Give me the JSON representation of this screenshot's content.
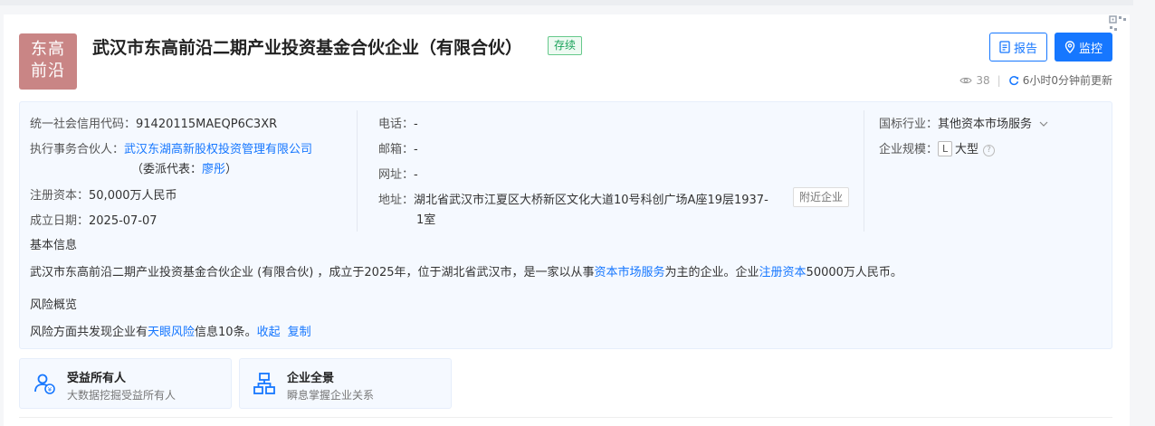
{
  "company": {
    "logo_line1": "东高",
    "logo_line2": "前沿",
    "name": "武汉市东高前沿二期产业投资基金合伙企业（有限合伙）",
    "status": "存续"
  },
  "actions": {
    "report_label": "报告",
    "monitor_label": "监控"
  },
  "meta": {
    "views": "38",
    "updated": "6小时0分钟前更新"
  },
  "info": {
    "credit_code_label": "统一社会信用代码：",
    "credit_code": "91420115MAEQP6C3XR",
    "partner_label": "执行事务合伙人：",
    "partner": "武汉东湖高新股权投资管理有限公司",
    "rep_prefix": "（委派代表：",
    "rep_name": "廖彤",
    "rep_suffix": "）",
    "capital_label": "注册资本：",
    "capital": "50,000万人民币",
    "founded_label": "成立日期：",
    "founded": "2025-07-07",
    "phone_label": "电话：",
    "phone": "-",
    "email_label": "邮箱：",
    "email": "-",
    "website_label": "网址：",
    "website": "-",
    "address_label": "地址：",
    "address_line1": "湖北省武汉市江夏区大桥新区文化大道10号科创广场A座19层1937-",
    "address_line2": "1室",
    "nearby_label": "附近企业",
    "industry_label": "国标行业：",
    "industry": "其他资本市场服务",
    "scale_label": "企业规模：",
    "scale_letter": "L",
    "scale": "大型"
  },
  "basic": {
    "heading": "基本信息",
    "text_1": "武汉市东高前沿二期产业投资基金合伙企业 (有限合伙) ，成立于2025年，位于湖北省武汉市，是一家以从事",
    "link_1": "资本市场服务",
    "text_2": "为主的企业。企业",
    "link_2": "注册资本",
    "text_3": "50000万人民币。"
  },
  "risk": {
    "heading": "风险概览",
    "text_1": "风险方面共发现企业有",
    "link_1": "天眼风险",
    "text_2": "信息10条。",
    "collapse": "收起",
    "copy": "复制"
  },
  "features": [
    {
      "title": "受益所有人",
      "subtitle": "大数据挖掘受益所有人",
      "icon": "beneficiary-icon"
    },
    {
      "title": "企业全景",
      "subtitle": "瞬息掌握企业关系",
      "icon": "org-chart-icon"
    }
  ],
  "colors": {
    "accent": "#1677ff",
    "status_green": "#1aa35a",
    "logo_bg": "#c98585"
  }
}
